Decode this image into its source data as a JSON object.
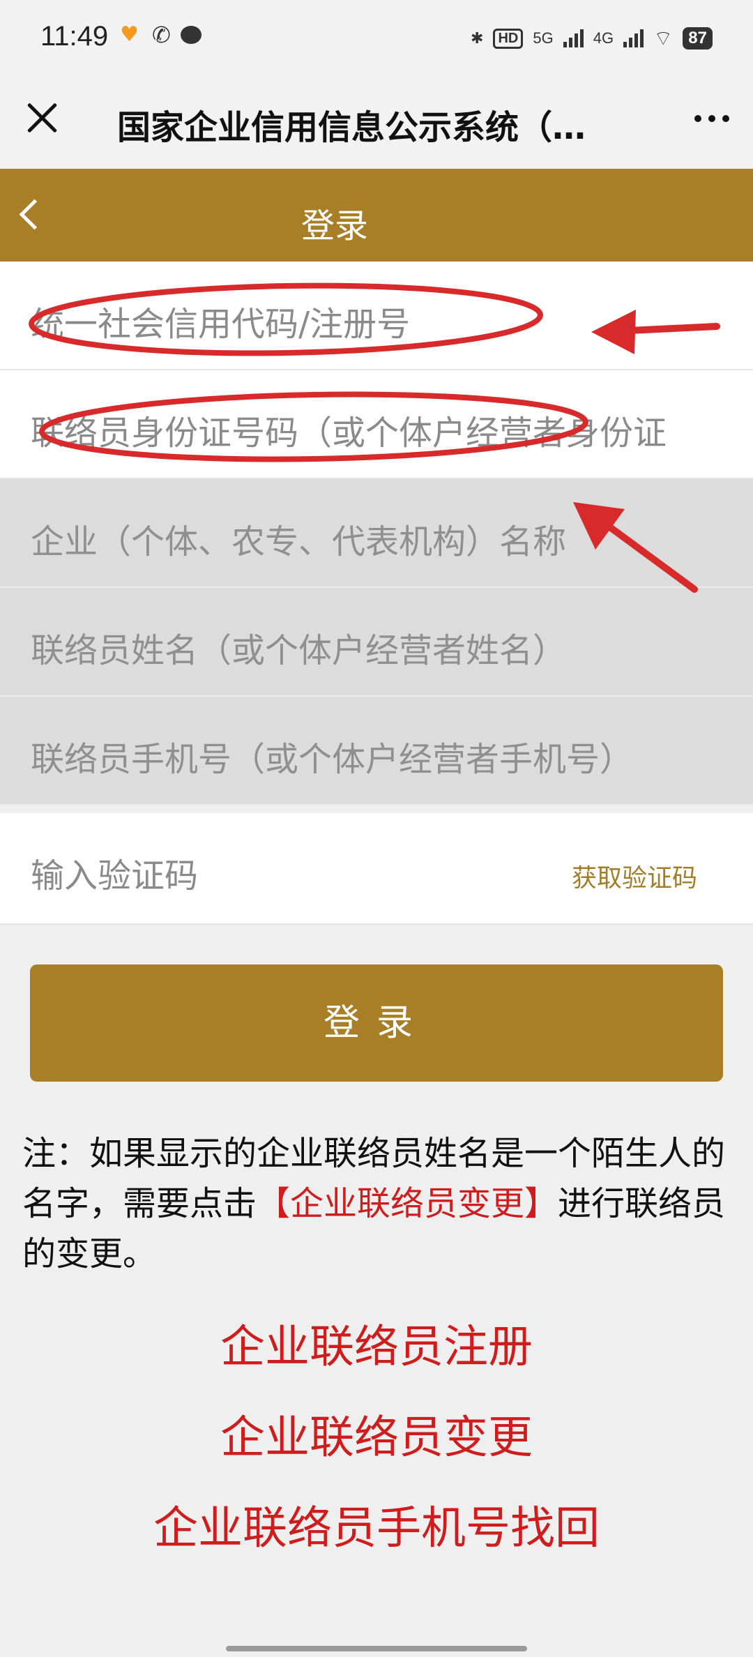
{
  "status_bar": {
    "time": "11:49",
    "hd": "HD",
    "net1": "5G",
    "net2": "4G",
    "battery": "87"
  },
  "title_bar": {
    "title": "国家企业信用信息公示系统（…"
  },
  "header": {
    "title": "登录"
  },
  "form": {
    "credit_code_placeholder": "统一社会信用代码/注册号",
    "id_number_placeholder": "联络员身份证号码（或个体户经营者身份证",
    "company_name_placeholder": "企业（个体、农专、代表机构）名称",
    "contact_name_placeholder": "联络员姓名（或个体户经营者姓名）",
    "phone_placeholder": "联络员手机号（或个体户经营者手机号）",
    "code_placeholder": "输入验证码",
    "get_code_label": "获取验证码",
    "login_label": "登录"
  },
  "note": {
    "part1": "注：如果显示的企业联络员姓名是一个陌生人的名字，需要点击",
    "highlight": "【企业联络员变更】",
    "part2": "进行联络员的变更。"
  },
  "links": {
    "register": "企业联络员注册",
    "change": "企业联络员变更",
    "recover_phone": "企业联络员手机号找回"
  },
  "colors": {
    "accent_gold": "#a87f27",
    "link_red": "#cf1c1c",
    "annotation_red": "#d82a2a"
  }
}
